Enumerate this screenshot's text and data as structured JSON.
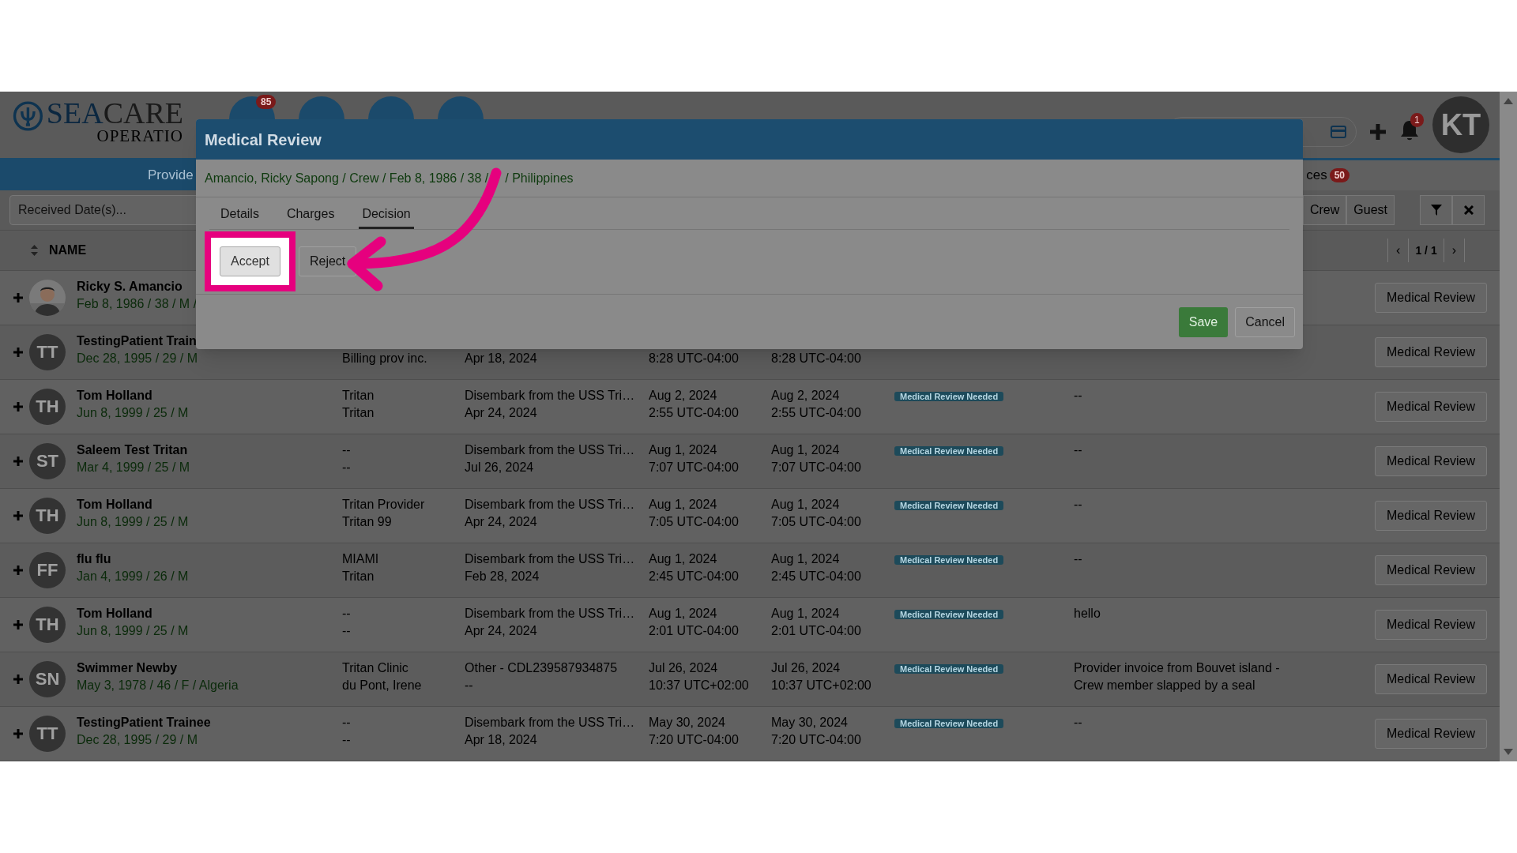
{
  "header": {
    "logo": {
      "part1": "SEA",
      "part2": "CARE",
      "sub": "OPERATIO"
    },
    "menu_badge": "85",
    "notifications_badge": "1",
    "avatar": "KT"
  },
  "nav": {
    "left_tab": "Provide",
    "right_tab": "ces",
    "right_badge": "50"
  },
  "filters": {
    "placeholder": "Received Date(s)...",
    "buttons": [
      {
        "label": "Crew"
      },
      {
        "label": "Guest"
      }
    ]
  },
  "table": {
    "columns": [
      "NAME"
    ],
    "prev": "‹",
    "pagination": "1 / 1",
    "next": "›",
    "rows": [
      {
        "name": "Ricky S. Amancio",
        "dob": "Feb 8, 1986 / 38 / M /",
        "action": "Medical Review"
      },
      {
        "name": "TestingPatient Train",
        "dob": "Dec 28, 1995 / 29 / M",
        "avatar": {
          "kind": "initials",
          "text": "TT"
        },
        "provider": {
          "bottom": "Billing prov inc."
        },
        "reason": {
          "bottom": "Apr 18, 2024"
        },
        "received": {
          "bottom": "8:28 UTC-04:00"
        },
        "updated": {
          "bottom": "8:28 UTC-04:00"
        },
        "action": "Medical Review"
      },
      {
        "name": "Tom Holland",
        "dob": "Jun 8, 1999 / 25 / M",
        "avatar": {
          "kind": "initials",
          "text": "TH"
        },
        "provider": {
          "top": "Tritan",
          "bottom": "Tritan"
        },
        "reason": {
          "top": "Disembark from the USS Tri…",
          "bottom": "Apr 24, 2024"
        },
        "received": {
          "top": "Aug 2, 2024",
          "bottom": "2:55 UTC-04:00"
        },
        "updated": {
          "top": "Aug 2, 2024",
          "bottom": "2:55 UTC-04:00"
        },
        "status": "Medical Review Needed",
        "notes": "--",
        "action": "Medical Review"
      },
      {
        "name": "Saleem Test Tritan",
        "dob": "Mar 4, 1999 / 25 / M",
        "avatar": {
          "kind": "initials",
          "text": "ST"
        },
        "provider": {
          "top": "--",
          "bottom": "--"
        },
        "reason": {
          "top": "Disembark from the USS Tri…",
          "bottom": "Jul 26, 2024"
        },
        "received": {
          "top": "Aug 1, 2024",
          "bottom": "7:07 UTC-04:00"
        },
        "updated": {
          "top": "Aug 1, 2024",
          "bottom": "7:07 UTC-04:00"
        },
        "status": "Medical Review Needed",
        "notes": "--",
        "action": "Medical Review"
      },
      {
        "name": "Tom Holland",
        "dob": "Jun 8, 1999 / 25 / M",
        "avatar": {
          "kind": "initials",
          "text": "TH"
        },
        "provider": {
          "top": "Tritan Provider",
          "bottom": "Tritan 99"
        },
        "reason": {
          "top": "Disembark from the USS Tri…",
          "bottom": "Apr 24, 2024"
        },
        "received": {
          "top": "Aug 1, 2024",
          "bottom": "7:05 UTC-04:00"
        },
        "updated": {
          "top": "Aug 1, 2024",
          "bottom": "7:05 UTC-04:00"
        },
        "status": "Medical Review Needed",
        "notes": "--",
        "action": "Medical Review"
      },
      {
        "name": "flu flu",
        "dob": "Jan 4, 1999 / 26 / M",
        "avatar": {
          "kind": "initials",
          "text": "FF"
        },
        "provider": {
          "top": "MIAMI",
          "bottom": "Tritan"
        },
        "reason": {
          "top": "Disembark from the USS Tri…",
          "bottom": "Feb 28, 2024"
        },
        "received": {
          "top": "Aug 1, 2024",
          "bottom": "2:45 UTC-04:00"
        },
        "updated": {
          "top": "Aug 1, 2024",
          "bottom": "2:45 UTC-04:00"
        },
        "status": "Medical Review Needed",
        "notes": "--",
        "action": "Medical Review"
      },
      {
        "name": "Tom Holland",
        "dob": "Jun 8, 1999 / 25 / M",
        "avatar": {
          "kind": "initials",
          "text": "TH"
        },
        "provider": {
          "top": "--",
          "bottom": "--"
        },
        "reason": {
          "top": "Disembark from the USS Tri…",
          "bottom": "Apr 24, 2024"
        },
        "received": {
          "top": "Aug 1, 2024",
          "bottom": "2:01 UTC-04:00"
        },
        "updated": {
          "top": "Aug 1, 2024",
          "bottom": "2:01 UTC-04:00"
        },
        "status": "Medical Review Needed",
        "notes": "hello",
        "action": "Medical Review"
      },
      {
        "name": "Swimmer Newby",
        "dob": "May 3, 1978 / 46 / F / Algeria",
        "avatar": {
          "kind": "initials",
          "text": "SN"
        },
        "provider": {
          "top": "Tritan Clinic",
          "bottom": "du Pont, Irene"
        },
        "reason": {
          "top": "Other - CDL239587934875",
          "bottom": "--"
        },
        "received": {
          "top": "Jul 26, 2024",
          "bottom": "10:37 UTC+02:00"
        },
        "updated": {
          "top": "Jul 26, 2024",
          "bottom": "10:37 UTC+02:00"
        },
        "status": "Medical Review Needed",
        "notes": "Provider invoice from Bouvet island - Crew member slapped by a seal",
        "action": "Medical Review"
      },
      {
        "name": "TestingPatient Trainee",
        "dob": "Dec 28, 1995 / 29 / M",
        "avatar": {
          "kind": "initials",
          "text": "TT"
        },
        "provider": {
          "top": "--",
          "bottom": "--"
        },
        "reason": {
          "top": "Disembark from the USS Tri…",
          "bottom": "Apr 18, 2024"
        },
        "received": {
          "top": "May 30, 2024",
          "bottom": "7:20 UTC-04:00"
        },
        "updated": {
          "top": "May 30, 2024",
          "bottom": "7:20 UTC-04:00"
        },
        "status": "Medical Review Needed",
        "notes": "--",
        "action": "Medical Review"
      }
    ]
  },
  "modal": {
    "title": "Medical Review",
    "patient": [
      "Amancio, Ricky Sapong / Crew / Feb 8, 1986 / 38 /",
      "/ Philippines"
    ],
    "tabs": [
      {
        "label": "Details",
        "selected": false
      },
      {
        "label": "Charges",
        "selected": false
      },
      {
        "label": "Decision",
        "selected": true
      }
    ],
    "decisions": [
      {
        "label": "Accept",
        "highlighted": true
      },
      {
        "label": "Reject",
        "highlighted": false
      }
    ],
    "save": "Save",
    "cancel": "Cancel"
  }
}
